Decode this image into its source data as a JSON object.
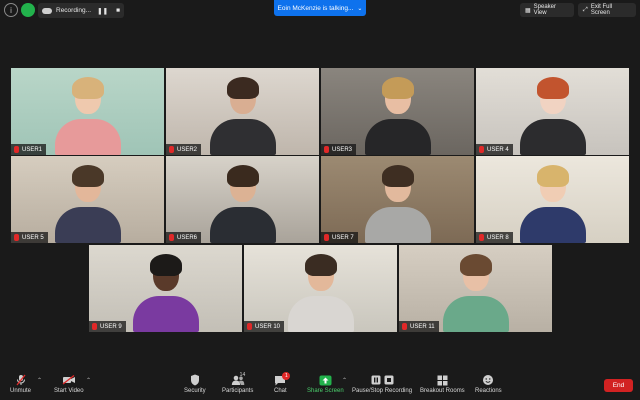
{
  "topbar": {
    "recording_label": "Recording...",
    "pause_icon": "pause-icon",
    "stop_icon": "stop-icon",
    "talking_banner": "Eoin McKenzie is talking...",
    "speaker_view": "Speaker View",
    "exit_full_screen": "Exit Full Screen"
  },
  "participants": [
    {
      "name": "USER1",
      "bg": "#9fc4b6",
      "wall": "#b9d6c8",
      "hair": "#d8b27a",
      "shirt": "#e79a9a",
      "skin": "#efc9ae"
    },
    {
      "name": "USER2",
      "bg": "#bfb6ac",
      "wall": "#ddd7cf",
      "hair": "#3b2a20",
      "shirt": "#2f2f32",
      "skin": "#d9ae92"
    },
    {
      "name": "USER3",
      "bg": "#6b6660",
      "wall": "#8a857e",
      "hair": "#c49b58",
      "shirt": "#262628",
      "skin": "#e8bea3"
    },
    {
      "name": "USER 4",
      "bg": "#c7c3bd",
      "wall": "#e2ded7",
      "hair": "#c2542e",
      "shirt": "#2c2c2e",
      "skin": "#f1d3c2"
    },
    {
      "name": "USER 5",
      "bg": "#b7ad9f",
      "wall": "#d6cdbf",
      "hair": "#4a3828",
      "shirt": "#3a3d55",
      "skin": "#e3b79a"
    },
    {
      "name": "USER6",
      "bg": "#a9a39a",
      "wall": "#d7d2c9",
      "hair": "#3a2a1e",
      "shirt": "#2a2d33",
      "skin": "#dcb294"
    },
    {
      "name": "USER 7",
      "bg": "#7d6a55",
      "wall": "#9c8a72",
      "hair": "#3e2e22",
      "shirt": "#a8a8a6",
      "skin": "#e2b99d"
    },
    {
      "name": "USER 8",
      "bg": "#d6d0c3",
      "wall": "#ece7dd",
      "hair": "#d8b46c",
      "shirt": "#2e3a6a",
      "skin": "#f0cdb4"
    },
    {
      "name": "USER 9",
      "bg": "#c3bfb6",
      "wall": "#dcd8cf",
      "hair": "#1c1a18",
      "shirt": "#7a3aa0",
      "skin": "#5a3a2a"
    },
    {
      "name": "USER 10",
      "bg": "#c9c6bd",
      "wall": "#e6e2d9",
      "hair": "#3a2c22",
      "shirt": "#d9d6d2",
      "skin": "#e3b89a"
    },
    {
      "name": "USER 11",
      "bg": "#b8b0a4",
      "wall": "#d6cec2",
      "hair": "#6a4a32",
      "shirt": "#6aa98a",
      "skin": "#e8c0a6"
    }
  ],
  "toolbar": {
    "unmute": "Unmute",
    "start_video": "Start Video",
    "security": "Security",
    "participants": "Participants",
    "participants_count": "14",
    "chat": "Chat",
    "chat_badge": "1",
    "share_screen": "Share Screen",
    "recording": "Pause/Stop Recording",
    "breakout_rooms": "Breakout Rooms",
    "reactions": "Reactions",
    "end": "End"
  },
  "colors": {
    "background": "#1a1a1a",
    "banner_blue": "#0e72ed",
    "share_green": "#22b24c",
    "end_red": "#d22222",
    "mute_red": "#e02828"
  }
}
